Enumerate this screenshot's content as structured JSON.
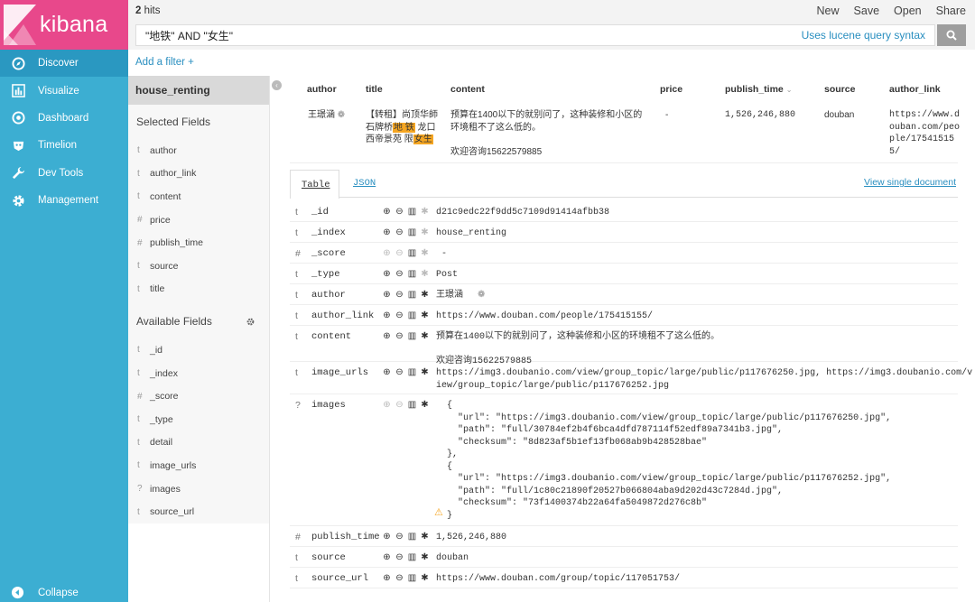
{
  "nav": {
    "brand": "kibana",
    "items": [
      {
        "label": "Discover",
        "icon": "compass-icon"
      },
      {
        "label": "Visualize",
        "icon": "bar-chart-icon"
      },
      {
        "label": "Dashboard",
        "icon": "dashboard-icon"
      },
      {
        "label": "Timelion",
        "icon": "timelion-icon"
      },
      {
        "label": "Dev Tools",
        "icon": "wrench-icon"
      },
      {
        "label": "Management",
        "icon": "gear-icon"
      }
    ],
    "collapse": "Collapse"
  },
  "topbar": {
    "hits_count": "2",
    "hits_label": "hits",
    "menu": [
      "New",
      "Save",
      "Open",
      "Share"
    ],
    "query": "\"地铁\" AND \"女生\"",
    "syntax_hint": "Uses lucene query syntax"
  },
  "filter": {
    "add_label": "Add a filter +"
  },
  "sidebar": {
    "index": "house_renting",
    "selected_title": "Selected Fields",
    "selected": [
      {
        "type": "t",
        "name": "author"
      },
      {
        "type": "t",
        "name": "author_link"
      },
      {
        "type": "t",
        "name": "content"
      },
      {
        "type": "#",
        "name": "price"
      },
      {
        "type": "#",
        "name": "publish_time"
      },
      {
        "type": "t",
        "name": "source"
      },
      {
        "type": "t",
        "name": "title"
      }
    ],
    "available_title": "Available Fields",
    "available": [
      {
        "type": "t",
        "name": "_id"
      },
      {
        "type": "t",
        "name": "_index"
      },
      {
        "type": "#",
        "name": "_score"
      },
      {
        "type": "t",
        "name": "_type"
      },
      {
        "type": "t",
        "name": "detail"
      },
      {
        "type": "t",
        "name": "image_urls"
      },
      {
        "type": "?",
        "name": "images"
      },
      {
        "type": "t",
        "name": "source_url"
      }
    ]
  },
  "table": {
    "headers": [
      "author",
      "title",
      "content",
      "price",
      "publish_time",
      "source",
      "author_link"
    ],
    "row": {
      "author": "王璟涵",
      "title_parts": [
        "【转租】尚顶华師石牌桥",
        "地 铁",
        " 龙口西帝景苑  限",
        "女生"
      ],
      "content": "预算在1400以下的就别问了，这种装修和小区的环境租不了这么低的。",
      "content2": "欢迎咨询15622579885",
      "price": "-",
      "publish_time": "1,526,246,880",
      "source": "douban",
      "author_link": "https://www.douban.com/people/175415155/"
    }
  },
  "detail": {
    "tab_table": "Table",
    "tab_json": "JSON",
    "view_single": "View single document",
    "fields": [
      {
        "type": "t",
        "name": "_id",
        "value": "d21c9edc22f9dd5c7109d91414afbb38"
      },
      {
        "type": "t",
        "name": "_index",
        "value": "house_renting"
      },
      {
        "type": "#",
        "name": "_score",
        "value": " -"
      },
      {
        "type": "t",
        "name": "_type",
        "value": "Post"
      },
      {
        "type": "t",
        "name": "author",
        "value": "王璟涵"
      },
      {
        "type": "t",
        "name": "author_link",
        "value": "https://www.douban.com/people/175415155/"
      },
      {
        "type": "t",
        "name": "content",
        "value": "预算在1400以下的就别问了，这种装修和小区的环境租不了这么低的。\n\n欢迎咨询15622579885"
      },
      {
        "type": "t",
        "name": "image_urls",
        "value": "https://img3.doubanio.com/view/group_topic/large/public/p117676250.jpg, https://img3.doubanio.com/v\niew/group_topic/large/public/p117676252.jpg"
      },
      {
        "type": "?",
        "name": "images",
        "value": "  {\n    \"url\": \"https://img3.doubanio.com/view/group_topic/large/public/p117676250.jpg\",\n    \"path\": \"full/30784ef2b4f6bca4dfd787114f52edf89a7341b3.jpg\",\n    \"checksum\": \"8d823af5b1ef13fb068ab9b428528bae\"\n  },\n  {\n    \"url\": \"https://img3.doubanio.com/view/group_topic/large/public/p117676252.jpg\",\n    \"path\": \"full/1c80c21890f20527b066804aba9d202d43c7284d.jpg\",\n    \"checksum\": \"73f1400374b22a64fa5049872d276c8b\"\n  }"
      },
      {
        "type": "#",
        "name": "publish_time",
        "value": "1,526,246,880"
      },
      {
        "type": "t",
        "name": "source",
        "value": "douban"
      },
      {
        "type": "t",
        "name": "source_url",
        "value": "https://www.douban.com/group/topic/117051753/"
      }
    ]
  }
}
